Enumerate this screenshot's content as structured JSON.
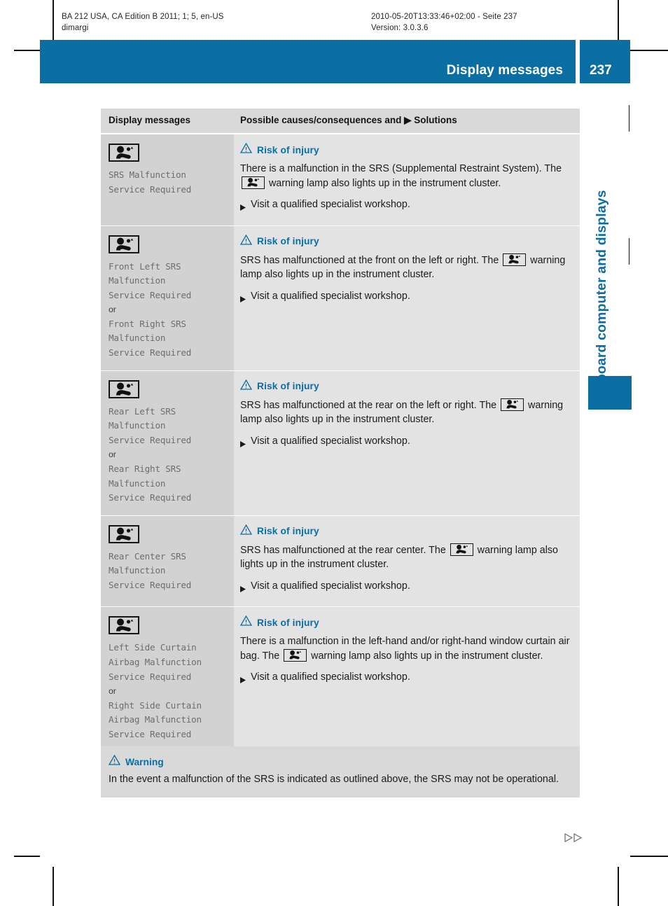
{
  "colors": {
    "accent": "#0b6ea3",
    "head_bg": "#d9d9d9",
    "cell_left": "#d2d2d2",
    "cell_right": "#e3e3e3"
  },
  "print_header": {
    "left_line1": "BA 212 USA, CA Edition B 2011; 1; 5, en-US",
    "left_line2": "dimargi",
    "right_line1": "2010-05-20T13:33:46+02:00 - Seite 237",
    "right_line2": "Version: 3.0.3.6"
  },
  "header": {
    "title": "Display messages",
    "page_number": "237"
  },
  "sidebar": {
    "chapter": "On-board computer and displays"
  },
  "table": {
    "columns": [
      "Display messages",
      "Possible causes/consequences and ▶ Solutions"
    ],
    "rows": [
      {
        "icon": "srs-airbag-warning-lamp-icon",
        "message_lines": [
          "SRS Malfunction",
          "Service Required"
        ],
        "risk_label": "Risk of injury",
        "body_pre": "There is a malfunction in the SRS (Supplemental Restraint System). The ",
        "body_post": " warning lamp also lights up in the instrument cluster.",
        "solution": "Visit a qualified specialist workshop."
      },
      {
        "icon": "srs-airbag-warning-lamp-icon",
        "message_lines": [
          "Front Left SRS",
          "Malfunction",
          "Service Required"
        ],
        "or_label": "or",
        "message_lines2": [
          "Front Right SRS",
          "Malfunction",
          "Service Required"
        ],
        "risk_label": "Risk of injury",
        "body_pre": "SRS has malfunctioned at the front on the left or right. The ",
        "body_post": " warning lamp also lights up in the instrument cluster.",
        "solution": "Visit a qualified specialist workshop."
      },
      {
        "icon": "srs-airbag-warning-lamp-icon",
        "message_lines": [
          "Rear Left SRS",
          "Malfunction",
          "Service Required"
        ],
        "or_label": "or",
        "message_lines2": [
          "Rear Right SRS",
          "Malfunction",
          "Service Required"
        ],
        "risk_label": "Risk of injury",
        "body_pre": "SRS has malfunctioned at the rear on the left or right. The ",
        "body_post": " warning lamp also lights up in the instrument cluster.",
        "solution": "Visit a qualified specialist workshop."
      },
      {
        "icon": "srs-airbag-warning-lamp-icon",
        "message_lines": [
          "Rear Center SRS",
          "Malfunction",
          "Service Required"
        ],
        "risk_label": "Risk of injury",
        "body_pre": "SRS has malfunctioned at the rear center. The ",
        "body_post": " warning lamp also lights up in the instrument cluster.",
        "solution": "Visit a qualified specialist workshop."
      },
      {
        "icon": "srs-airbag-warning-lamp-icon",
        "message_lines": [
          "Left Side Curtain",
          "Airbag Malfunction",
          "Service Required"
        ],
        "or_label": "or",
        "message_lines2": [
          "Right Side Curtain",
          "Airbag Malfunction",
          "Service Required"
        ],
        "risk_label": "Risk of injury",
        "body_pre": "There is a malfunction in the left-hand and/or right-hand window curtain air bag. The ",
        "body_post": " warning lamp also lights up in the instrument cluster.",
        "solution": "Visit a qualified specialist workshop."
      }
    ]
  },
  "warning_box": {
    "label": "Warning",
    "text": "In the event a malfunction of the SRS is indicated as outlined above, the SRS may not be operational."
  },
  "continue_marker": "▷▷"
}
